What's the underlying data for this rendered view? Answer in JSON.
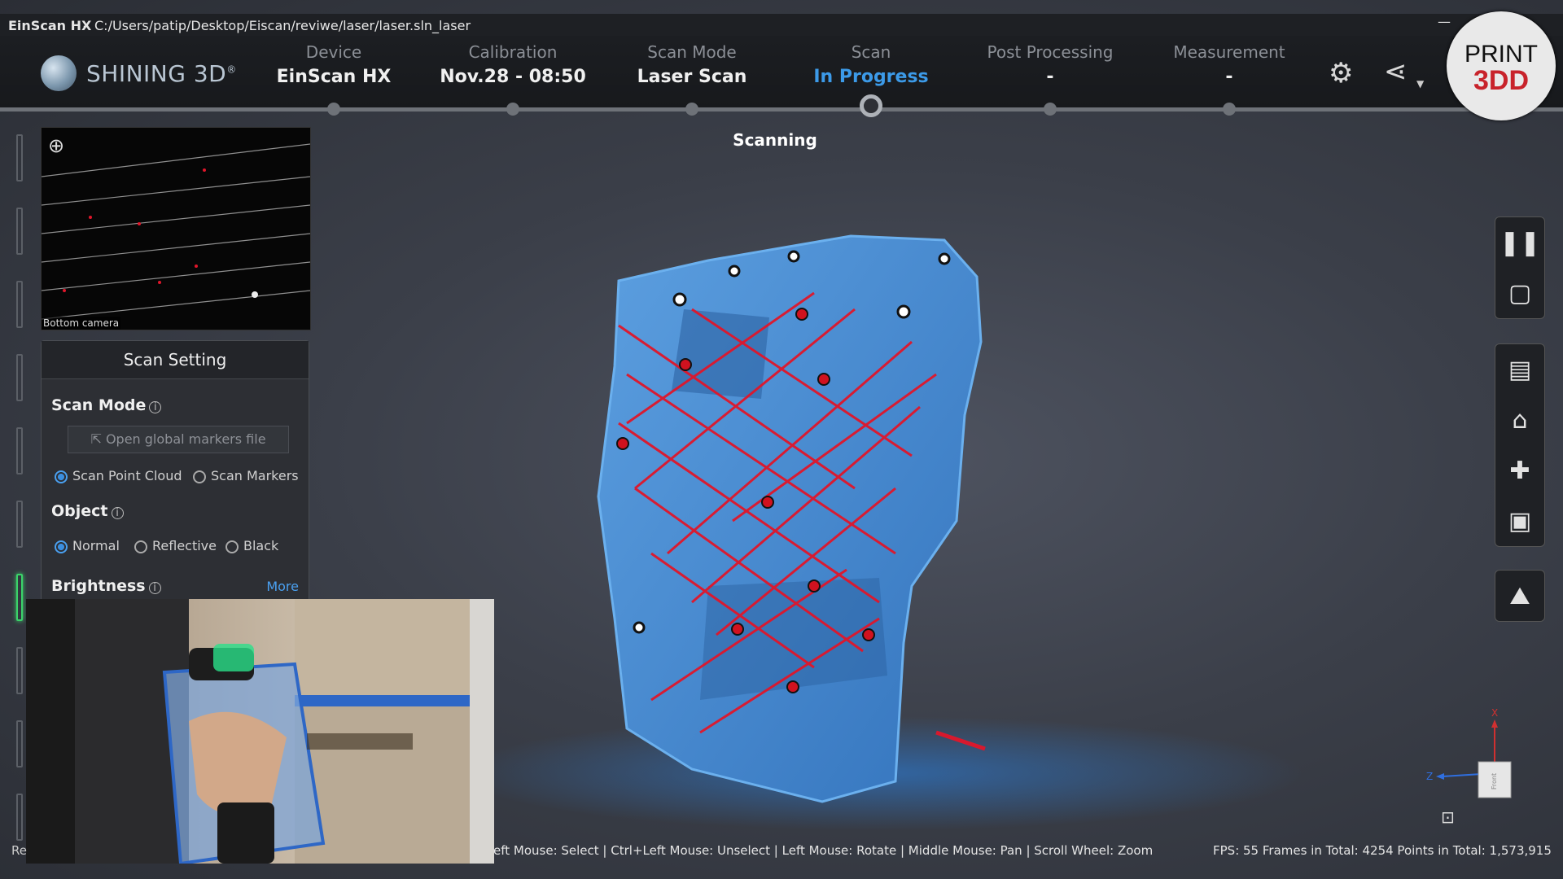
{
  "window": {
    "app_name": "EinScan HX",
    "path": "C:/Users/patip/Desktop/Eiscan/reviwe/laser/laser.sln_laser"
  },
  "brand": {
    "logo_text": "SHINING 3D",
    "logo_reg": "®"
  },
  "steps": [
    {
      "label": "Device",
      "value": "EinScan HX"
    },
    {
      "label": "Calibration",
      "value": "Nov.28 - 08:50"
    },
    {
      "label": "Scan Mode",
      "value": "Laser Scan"
    },
    {
      "label": "Scan",
      "value": "In Progress"
    },
    {
      "label": "Post Processing",
      "value": "-"
    },
    {
      "label": "Measurement",
      "value": "-"
    }
  ],
  "active_step": "Scan",
  "header_icons": [
    "new-feature-icon",
    "share-icon"
  ],
  "watermark": {
    "line1": "PRINT",
    "line2": "3DD"
  },
  "status_text": "Scanning",
  "camera": {
    "label": "Bottom camera",
    "zoom_icon": "zoom-in-icon"
  },
  "scan_setting": {
    "title": "Scan Setting",
    "scan_mode": {
      "label": "Scan Mode",
      "button": "Open global markers file",
      "options": [
        "Scan Point Cloud",
        "Scan Markers"
      ],
      "selected": "Scan Point Cloud"
    },
    "object": {
      "label": "Object",
      "options": [
        "Normal",
        "Reflective",
        "Black"
      ],
      "selected": "Normal"
    },
    "brightness": {
      "label": "Brightness",
      "more": "More"
    }
  },
  "right_toolbar": {
    "group1": [
      "pause-icon",
      "stop-icon"
    ],
    "group2": [
      "window-icon",
      "toolbox-icon",
      "puzzle-icon",
      "save-icon"
    ],
    "group3": [
      "point-cloud-icon"
    ]
  },
  "footer": {
    "left_cut": "Re",
    "hint": "eft Mouse: Select | Ctrl+Left Mouse: Unselect | Left Mouse: Rotate | Middle Mouse: Pan | Scroll Wheel: Zoom",
    "stats": "FPS:  55  Frames in Total: 4254  Points in Total: 1,573,915"
  },
  "axes": {
    "x": "X",
    "z": "Z",
    "cube_face": "Front"
  },
  "colors": {
    "accent": "#3c9ae8",
    "scan_blue": "#3f86cf",
    "laser_red": "#e0162a",
    "status_green": "#3bd36a"
  }
}
